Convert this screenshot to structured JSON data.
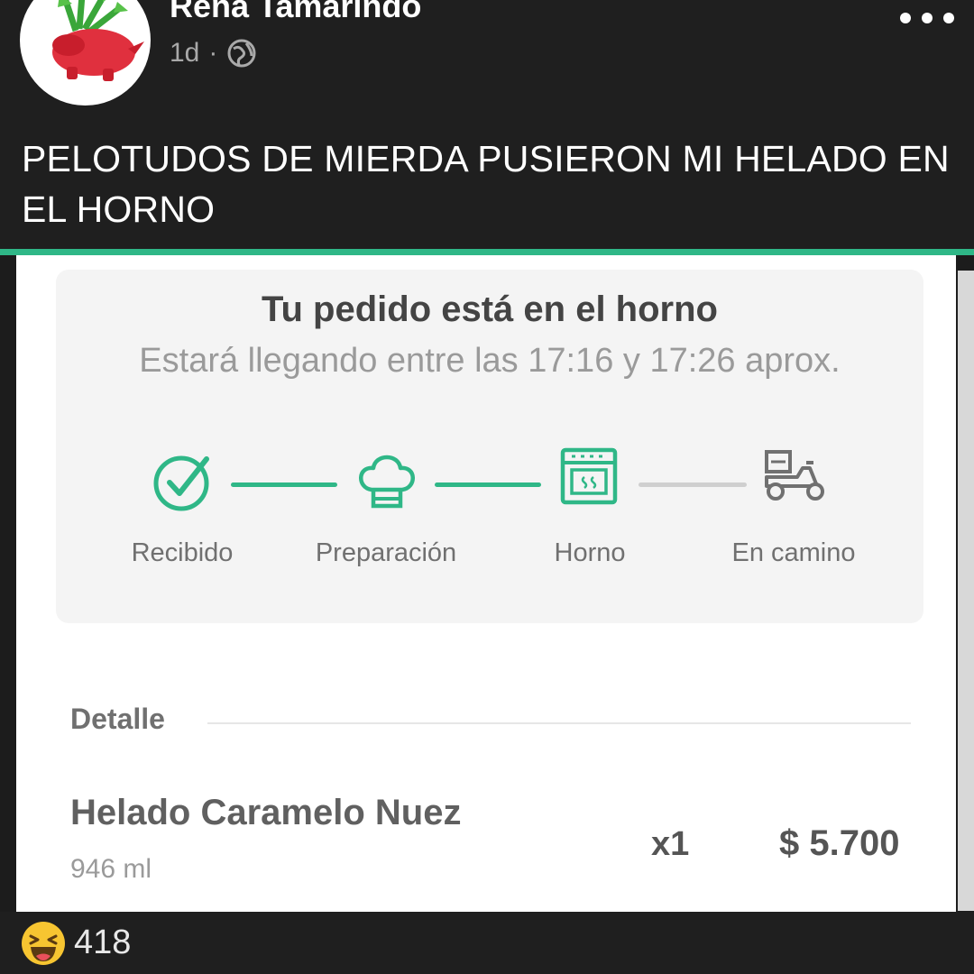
{
  "post": {
    "author": "Rena Tamarindo",
    "time": "1d",
    "separator": "·",
    "privacy_icon": "globe-icon",
    "menu_icon": "more-dots-icon",
    "caption": "PELOTUDOS DE MIERDA PUSIERON MI HELADO EN EL HORNO"
  },
  "order_status": {
    "title": "Tu pedido está en el horno",
    "subtitle": "Estará llegando entre las 17:16 y 17:26 aprox.",
    "steps": [
      {
        "label": "Recibido",
        "icon": "check-circle-icon",
        "complete": true
      },
      {
        "label": "Preparación",
        "icon": "chef-hat-icon",
        "complete": true
      },
      {
        "label": "Horno",
        "icon": "oven-icon",
        "complete": true
      },
      {
        "label": "En camino",
        "icon": "delivery-scooter-icon",
        "complete": false
      }
    ]
  },
  "detail": {
    "title": "Detalle",
    "items": [
      {
        "name": "Helado Caramelo Nuez",
        "size": "946 ml",
        "qty": "x1",
        "price": "$ 5.700"
      }
    ]
  },
  "reactions": {
    "icon": "haha-emoji-icon",
    "count": "418"
  },
  "colors": {
    "accent_green": "#2fb787",
    "pending_gray": "#cfcfcf",
    "post_background": "#1f1f1f"
  }
}
